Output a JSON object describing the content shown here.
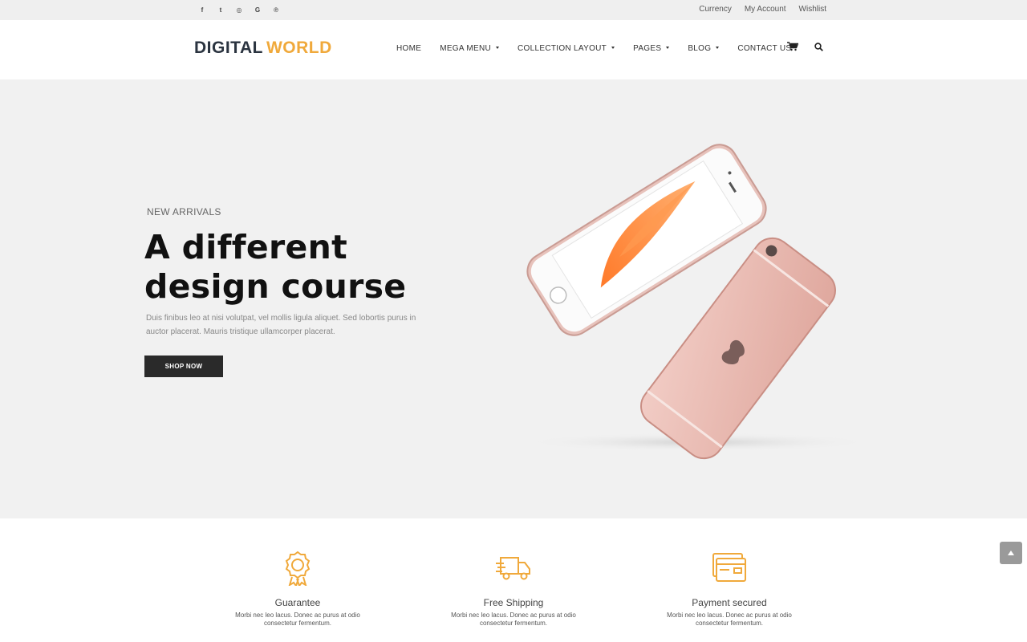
{
  "topbar": {
    "social": [
      {
        "icon": "facebook-icon",
        "glyph": "f"
      },
      {
        "icon": "twitter-icon",
        "glyph": "t"
      },
      {
        "icon": "instagram-icon",
        "glyph": "◎"
      },
      {
        "icon": "google-icon",
        "glyph": "G"
      },
      {
        "icon": "pinterest-icon",
        "glyph": "℗"
      }
    ],
    "links": [
      "Currency",
      "My Account",
      "Wishlist"
    ]
  },
  "header": {
    "logo_part1": "DIGITAL",
    "logo_part2": "WORLD",
    "nav": [
      {
        "label": "HOME",
        "dropdown": false
      },
      {
        "label": "MEGA MENU",
        "dropdown": true
      },
      {
        "label": "COLLECTION LAYOUT",
        "dropdown": true
      },
      {
        "label": "PAGES",
        "dropdown": true
      },
      {
        "label": "BLOG",
        "dropdown": true
      },
      {
        "label": "CONTACT US",
        "dropdown": false
      }
    ]
  },
  "hero": {
    "eyebrow": "NEW ARRIVALS",
    "title": "A different design course",
    "description": "Duis finibus leo at nisi volutpat, vel mollis ligula aliquet. Sed lobortis purus in auctor placerat. Mauris tristique ullamcorper placerat.",
    "button": "SHOP NOW"
  },
  "features": [
    {
      "icon": "guarantee-icon",
      "title": "Guarantee",
      "description": "Morbi nec leo lacus. Donec ac purus at odio consectetur fermentum."
    },
    {
      "icon": "truck-icon",
      "title": "Free Shipping",
      "description": "Morbi nec leo lacus. Donec ac purus at odio consectetur fermentum."
    },
    {
      "icon": "credit-card-icon",
      "title": "Payment secured",
      "description": "Morbi nec leo lacus. Donec ac purus at odio consectetur fermentum."
    }
  ],
  "colors": {
    "accent": "#f0a93b",
    "dark": "#2a2a2a",
    "hero_bg": "#f1f1f1"
  }
}
